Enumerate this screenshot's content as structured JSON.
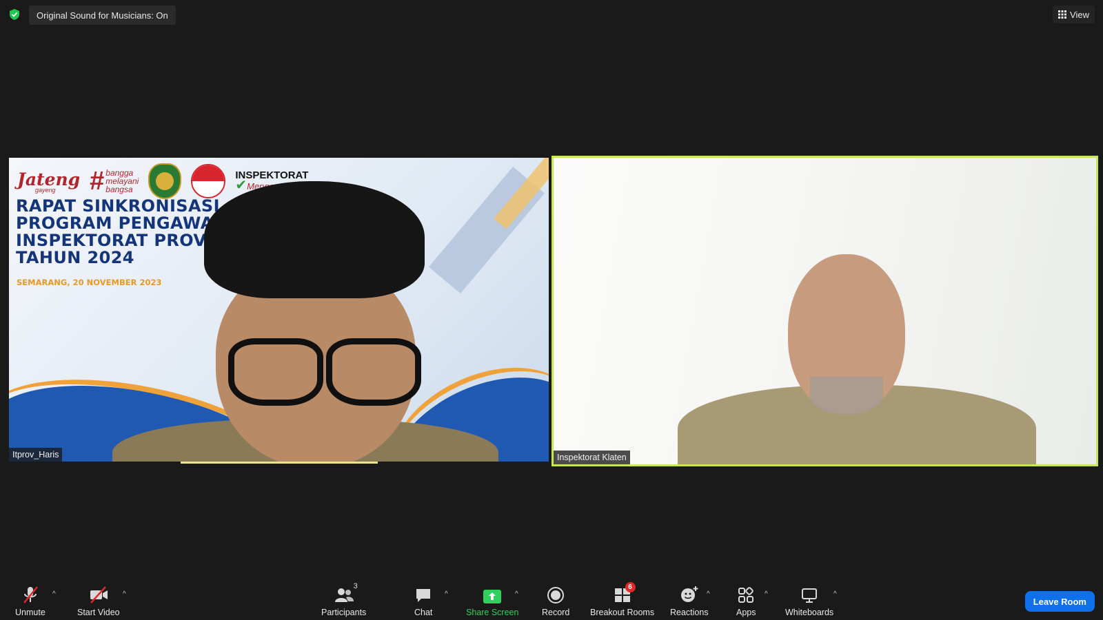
{
  "top_bar": {
    "original_sound_label": "Original Sound for Musicians: On",
    "view_label": "View"
  },
  "tiles": {
    "left": {
      "participant_name": "Itprov_Haris",
      "banner": {
        "logo_jateng": "Jateng",
        "logo_jateng_sub": "gayeng",
        "logo_hashtag_lines": [
          "bangga",
          "melayani",
          "bangsa"
        ],
        "logo_inspektorat": "INSPEKTORAT",
        "logo_inspektorat_sub": "Mengawal",
        "title_lines": [
          "RAPAT SINKRONISASI",
          "PROGRAM PENGAWAS",
          "INSPEKTORAT PROV",
          "TAHUN 2024"
        ],
        "date": "SEMARANG, 20 NOVEMBER 2023"
      }
    },
    "right": {
      "participant_name": "Inspektorat Klaten",
      "active_speaker_color": "#c7e65a"
    }
  },
  "toolbar": {
    "unmute_label": "Unmute",
    "start_video_label": "Start Video",
    "participants_label": "Participants",
    "participants_count": "3",
    "chat_label": "Chat",
    "share_screen_label": "Share Screen",
    "record_label": "Record",
    "breakout_rooms_label": "Breakout Rooms",
    "breakout_rooms_badge": "6",
    "reactions_label": "Reactions",
    "apps_label": "Apps",
    "whiteboards_label": "Whiteboards",
    "leave_label": "Leave Room",
    "accent_green": "#2fd05c",
    "leave_color": "#0e71eb",
    "mute_slash_color": "#e02828"
  }
}
